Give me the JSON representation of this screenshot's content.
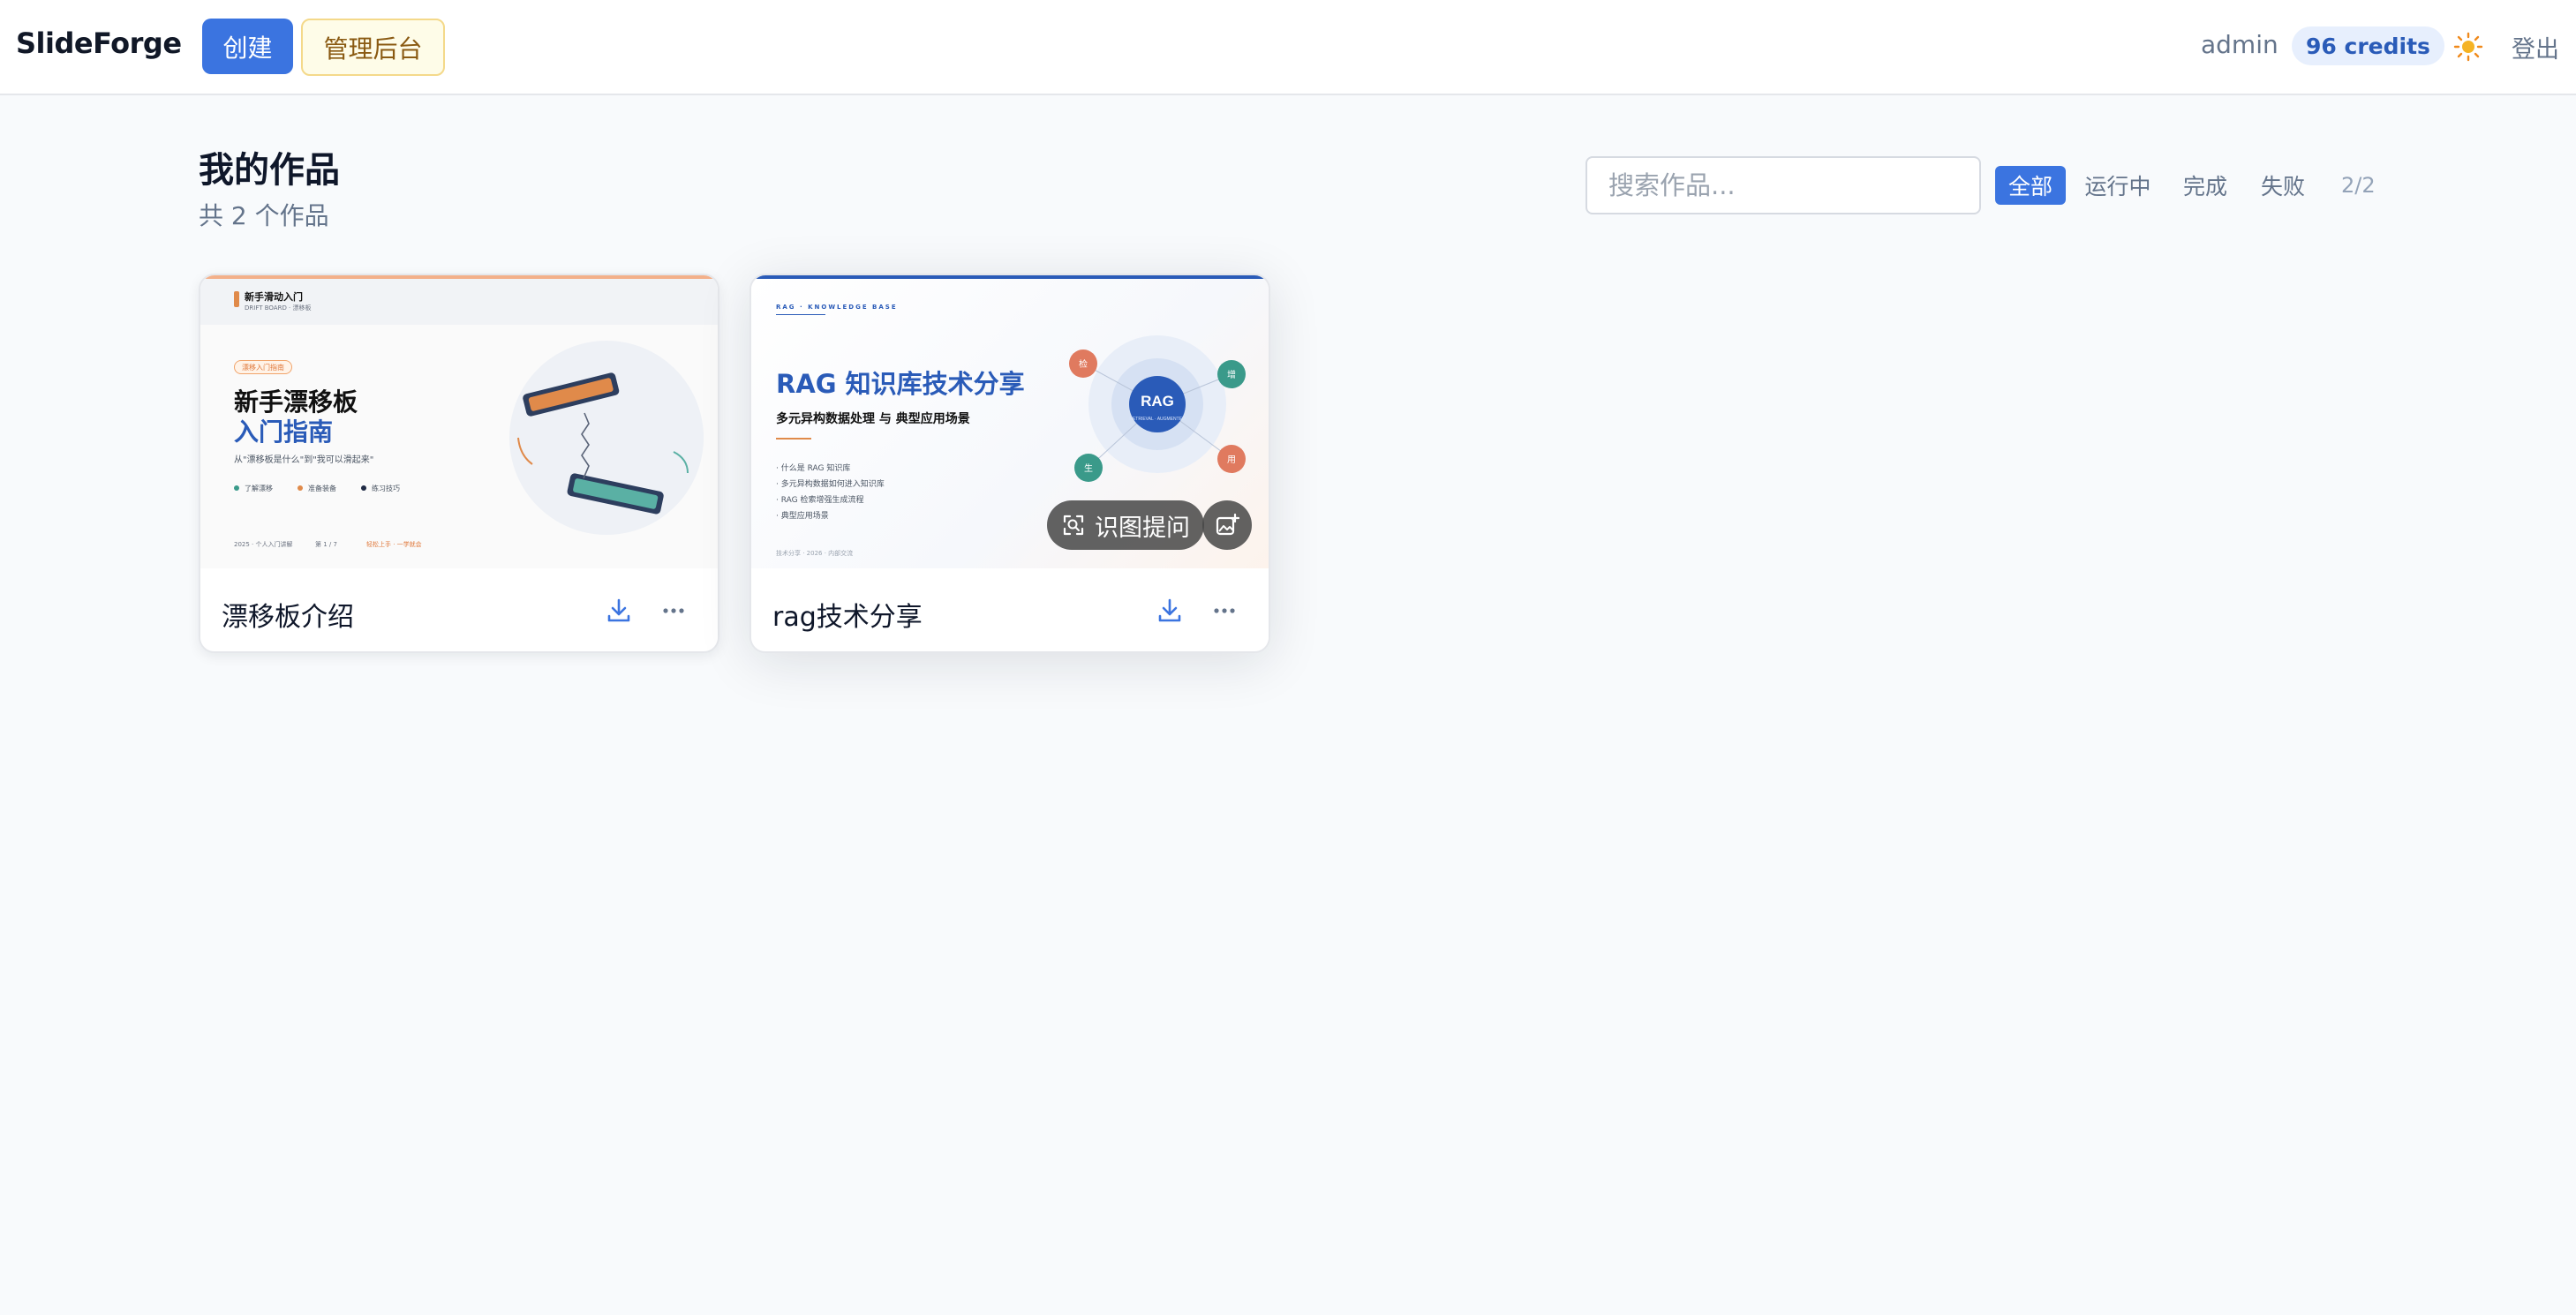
{
  "nav": {
    "brand": "SlideForge",
    "create_label": "创建",
    "admin_label": "管理后台",
    "user": "admin",
    "credits": "96 credits",
    "theme_icon": "sun-icon",
    "logout_label": "登出"
  },
  "header": {
    "title": "我的作品",
    "subtitle": "共 2 个作品"
  },
  "search": {
    "placeholder": "搜索作品...",
    "value": ""
  },
  "filters": [
    {
      "label": "全部",
      "active": true
    },
    {
      "label": "运行中",
      "active": false
    },
    {
      "label": "完成",
      "active": false
    },
    {
      "label": "失败",
      "active": false
    }
  ],
  "count": "2/2",
  "cards": [
    {
      "title": "漂移板介绍",
      "thumb": {
        "top_label": "新手滑动入门",
        "top_sub": "DRIFT BOARD · 漂移板",
        "tag": "漂移入门指南",
        "title_line1": "新手漂移板",
        "title_line2": "入门指南",
        "subtitle": "从\"漂移板是什么\"到\"我可以滑起来\"",
        "bullets": [
          "了解漂移",
          "准备装备",
          "练习技巧"
        ],
        "footer_left": "2025 · 个人入门讲解",
        "footer_mid": "第 1 / 7",
        "footer_right": "轻松上手 · 一学就会"
      },
      "colors": {
        "accent": "#e08a4a",
        "title_blue": "#2a5bb8"
      }
    },
    {
      "title": "rag技术分享",
      "thumb": {
        "top_label": "RAG · KNOWLEDGE BASE",
        "title": "RAG 知识库技术分享",
        "subtitle": "多元异构数据处理 与 典型应用场景",
        "bullets": [
          "什么是 RAG 知识库",
          "多元异构数据如何进入知识库",
          "RAG 检索增强生成流程",
          "典型应用场景"
        ],
        "footer": "技术分享 · 2026 · 内部交流",
        "center_label": "RAG",
        "center_sub": "RETRIEVAL · AUGMENTED",
        "nodes": [
          "检",
          "增",
          "生",
          "用"
        ]
      },
      "overlay": {
        "ocr_label": "识图提问",
        "ocr_icon": "scan-icon",
        "add_icon": "image-add-icon"
      },
      "colors": {
        "accent": "#2a5bb8"
      }
    }
  ]
}
